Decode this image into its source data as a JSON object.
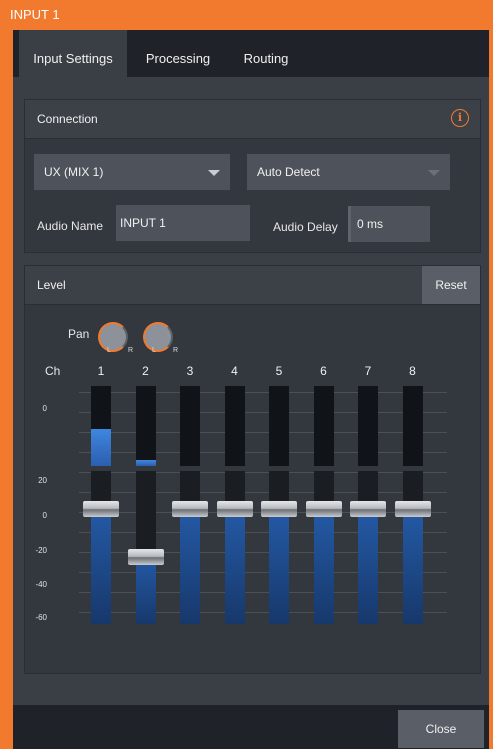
{
  "window": {
    "title": "INPUT 1"
  },
  "tabs": [
    {
      "label": "Input Settings"
    },
    {
      "label": "Processing"
    },
    {
      "label": "Routing"
    }
  ],
  "connection": {
    "title": "Connection",
    "source": "UX (MIX 1)",
    "detect": "Auto Detect",
    "audio_name_label": "Audio Name",
    "audio_name": "INPUT 1",
    "audio_delay_label": "Audio Delay",
    "audio_delay": "0 ms"
  },
  "level": {
    "title": "Level",
    "reset_label": "Reset",
    "pan_label": "Pan",
    "pan_l": "L",
    "pan_r": "R",
    "ch_label": "Ch",
    "meter_scale": [
      "0"
    ],
    "fader_scale": [
      "20",
      "0",
      "-20",
      "-40",
      "-60"
    ],
    "channels": [
      {
        "label": "1",
        "meter_level": 0.46,
        "fader_db": 0
      },
      {
        "label": "2",
        "meter_level": 0.08,
        "fader_db": -25
      },
      {
        "label": "3",
        "meter_level": 0,
        "fader_db": 0
      },
      {
        "label": "4",
        "meter_level": 0,
        "fader_db": 0
      },
      {
        "label": "5",
        "meter_level": 0,
        "fader_db": 0
      },
      {
        "label": "6",
        "meter_level": 0,
        "fader_db": 0
      },
      {
        "label": "7",
        "meter_level": 0,
        "fader_db": 0
      },
      {
        "label": "8",
        "meter_level": 0,
        "fader_db": 0
      }
    ]
  },
  "footer": {
    "close_label": "Close"
  },
  "colors": {
    "accent": "#f27a2e",
    "meter": "#3f86e0",
    "fader_fill": "#1f4f94"
  }
}
